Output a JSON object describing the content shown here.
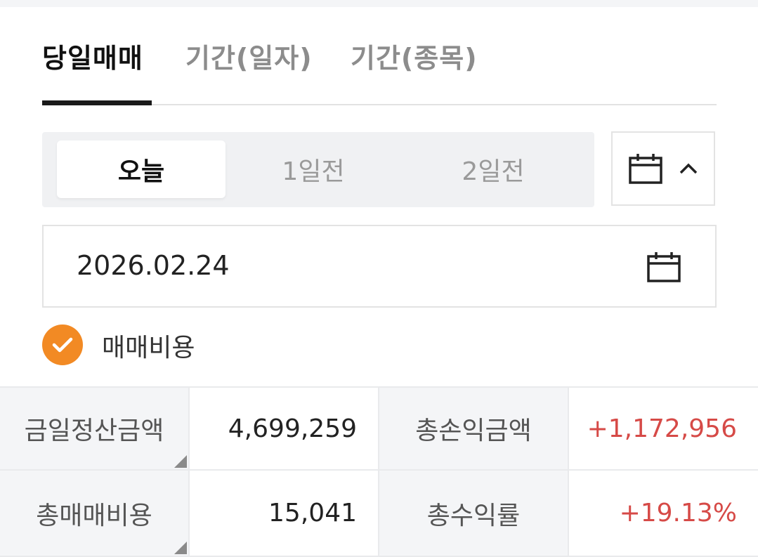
{
  "tabs": [
    {
      "label": "당일매매",
      "active": true
    },
    {
      "label": "기간(일자)",
      "active": false
    },
    {
      "label": "기간(종목)",
      "active": false
    }
  ],
  "day_selector": {
    "options": [
      "오늘",
      "1일전",
      "2일전"
    ],
    "selected": "오늘"
  },
  "date_field": {
    "value": "2026.02.24"
  },
  "trade_cost_checkbox": {
    "label": "매매비용",
    "checked": true
  },
  "summary": {
    "settlement_label": "금일정산금액",
    "settlement_value": "4,699,259",
    "total_pl_label": "총손익금액",
    "total_pl_value": "+1,172,956",
    "total_cost_label": "총매매비용",
    "total_cost_value": "15,041",
    "return_label": "총수익률",
    "return_value": "+19.13%"
  },
  "colors": {
    "accent": "#f28a24",
    "positive": "#d64a47",
    "label_bg": "#f4f5f7"
  }
}
